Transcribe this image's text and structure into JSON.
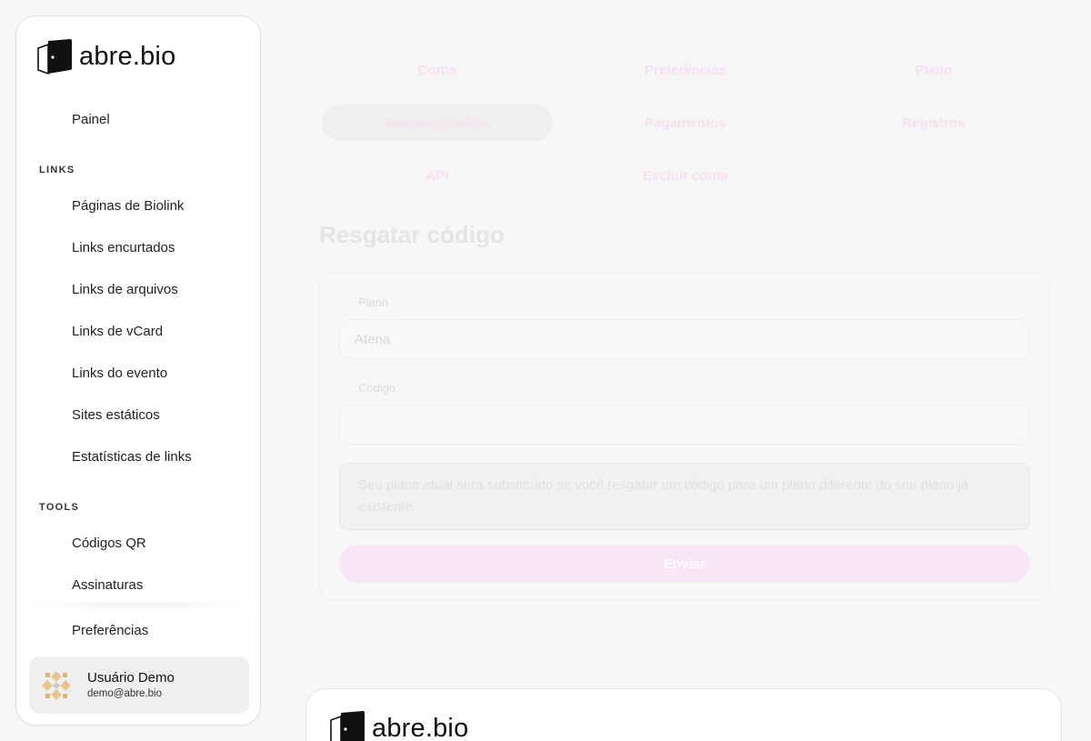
{
  "brand": {
    "name": "abre.bio"
  },
  "sidebar": {
    "top_item": "Painel",
    "section_links": "LINKS",
    "links_items": [
      "Páginas de Biolink",
      "Links encurtados",
      "Links de arquivos",
      "Links de vCard",
      "Links do evento",
      "Sites estáticos",
      "Estatísticas de links"
    ],
    "section_tools": "TOOLS",
    "tools_items": [
      "Códigos QR",
      "Assinaturas"
    ],
    "bottom_item": "Preferências",
    "user": {
      "name": "Usuário Demo",
      "email": "demo@abre.bio"
    }
  },
  "tabs": [
    "Conta",
    "Preferências",
    "Plano",
    "Resgatar código",
    "Pagamentos",
    "Registros",
    "API",
    "Excluir conta"
  ],
  "active_tab": "Resgatar código",
  "page": {
    "title": "Resgatar código",
    "plan_label": "Plano",
    "plan_value": "Atena",
    "code_label": "Código",
    "code_value": "",
    "notice": "Seu plano atual será substituído se você resgatar um código para um plano diferente do seu plano já existente.",
    "submit": "Enviar"
  },
  "colors": {
    "accent_faded": "#f7e6f3",
    "tab_text": "#f6e1f0"
  }
}
